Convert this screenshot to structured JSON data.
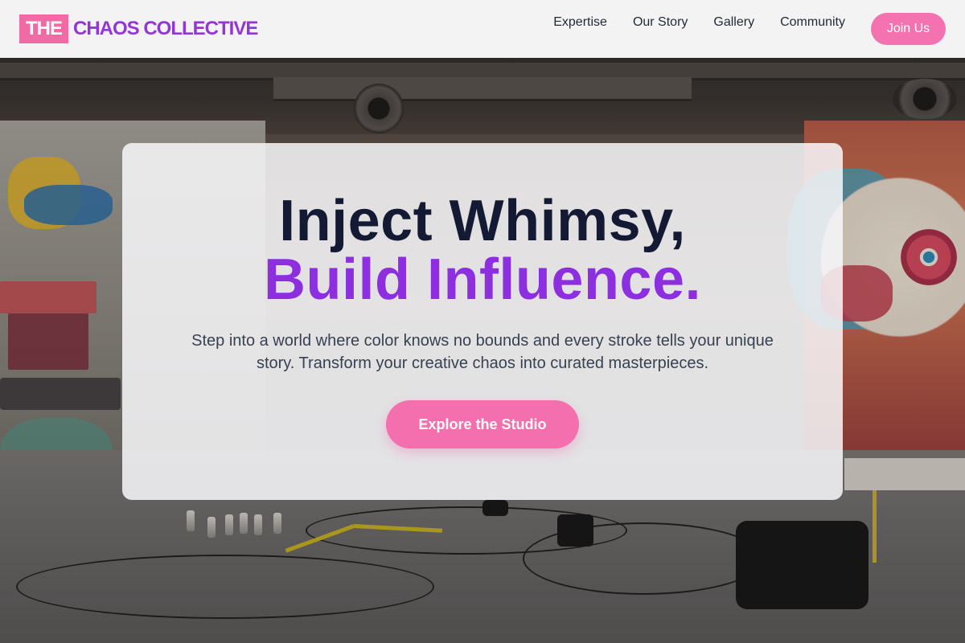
{
  "header": {
    "logo_prefix": "THE",
    "logo_name": "CHAOS COLLECTIVE",
    "nav": [
      {
        "label": "Expertise"
      },
      {
        "label": "Our Story"
      },
      {
        "label": "Gallery"
      },
      {
        "label": "Community"
      }
    ],
    "cta_label": "Join Us"
  },
  "hero": {
    "title_line1": "Inject Whimsy,",
    "title_line2": "Build Influence.",
    "subtitle": "Step into a world where color knows no bounds and every stroke tells your unique story. Transform your creative chaos into curated masterpieces.",
    "cta_label": "Explore the Studio"
  },
  "colors": {
    "brand_pink": "#f26aa4",
    "brand_purple": "#9436d6",
    "heading_dark": "#141a33",
    "button_pink": "#f36fad"
  }
}
